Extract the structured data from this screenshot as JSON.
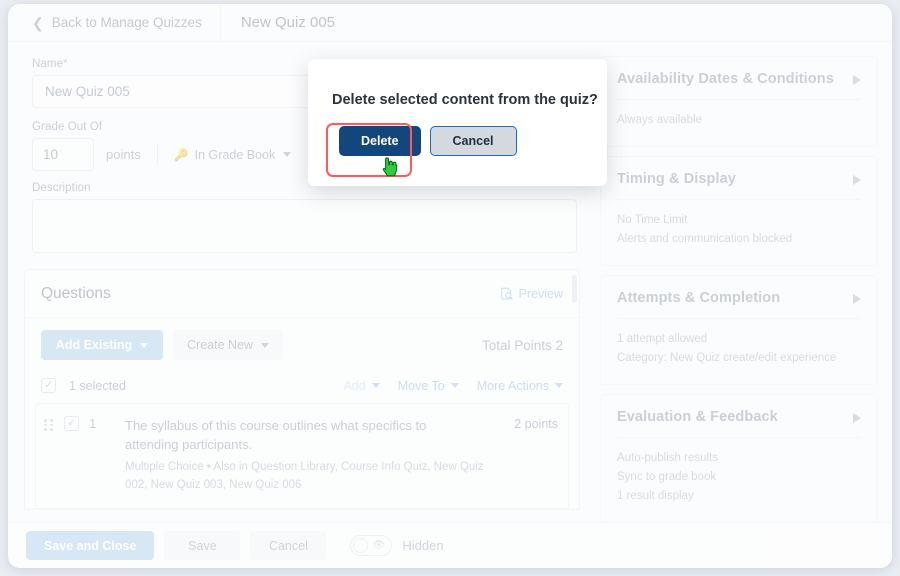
{
  "header": {
    "back_label": "Back to Manage Quizzes",
    "back_icon": "chevron-left-icon",
    "quiz_title": "New Quiz 005"
  },
  "form": {
    "name_label": "Name",
    "name_required_mark": "*",
    "name_value": "New Quiz 005",
    "grade_label": "Grade Out Of",
    "grade_value": "10",
    "points_label": "points",
    "gradebook_label": "In Grade Book",
    "gradebook_icon": "key-icon",
    "help_icon": "help-circle-icon",
    "help_glyph": "?",
    "description_label": "Description",
    "description_value": ""
  },
  "questions": {
    "section_title": "Questions",
    "preview_label": "Preview",
    "preview_icon": "document-search-icon",
    "add_existing_label": "Add Existing",
    "create_new_label": "Create New",
    "total_points_label": "Total Points 2",
    "selected_label": "1 selected",
    "selected_checkbox_glyph": "✓",
    "actions": [
      {
        "label": "Add",
        "disabled": true
      },
      {
        "label": "Move To",
        "disabled": false
      },
      {
        "label": "More Actions",
        "disabled": false
      }
    ],
    "rows": [
      {
        "number": "1",
        "checked_glyph": "✓",
        "text": "The syllabus of this course outlines what specifics to attending participants.",
        "meta": "Multiple Choice  •  Also in Question Library, Course Info Quiz, New Quiz 002, New Quiz 003, New Quiz 006",
        "points": "2 points"
      }
    ]
  },
  "panels": [
    {
      "title": "Availability Dates & Conditions",
      "expand_icon": "triangle-right-icon",
      "lines": [
        "Always available"
      ]
    },
    {
      "title": "Timing & Display",
      "expand_icon": "triangle-right-icon",
      "lines": [
        "No Time Limit",
        "Alerts and communication blocked"
      ]
    },
    {
      "title": "Attempts & Completion",
      "expand_icon": "triangle-right-icon",
      "lines": [
        "1 attempt allowed",
        "Category: New Quiz create/edit experience"
      ]
    },
    {
      "title": "Evaluation & Feedback",
      "expand_icon": "triangle-right-icon",
      "lines": [
        "Auto-publish results",
        "Sync to grade book",
        "1 result display"
      ]
    }
  ],
  "footer": {
    "save_and_close_label": "Save and Close",
    "save_label": "Save",
    "cancel_label": "Cancel",
    "hidden_label": "Hidden",
    "toggle_icon": "eye-slash-icon",
    "toggle_state": "off"
  },
  "dialog": {
    "title": "Delete selected content from the quiz?",
    "delete_label": "Delete",
    "cancel_label": "Cancel",
    "highlight_color": "#ff5a5a",
    "delete_color": "#14467e",
    "cancel_border_color": "#1a6bbd"
  },
  "cursor": {
    "icon": "hand-pointer-cursor",
    "color": "#2ecc3f"
  }
}
